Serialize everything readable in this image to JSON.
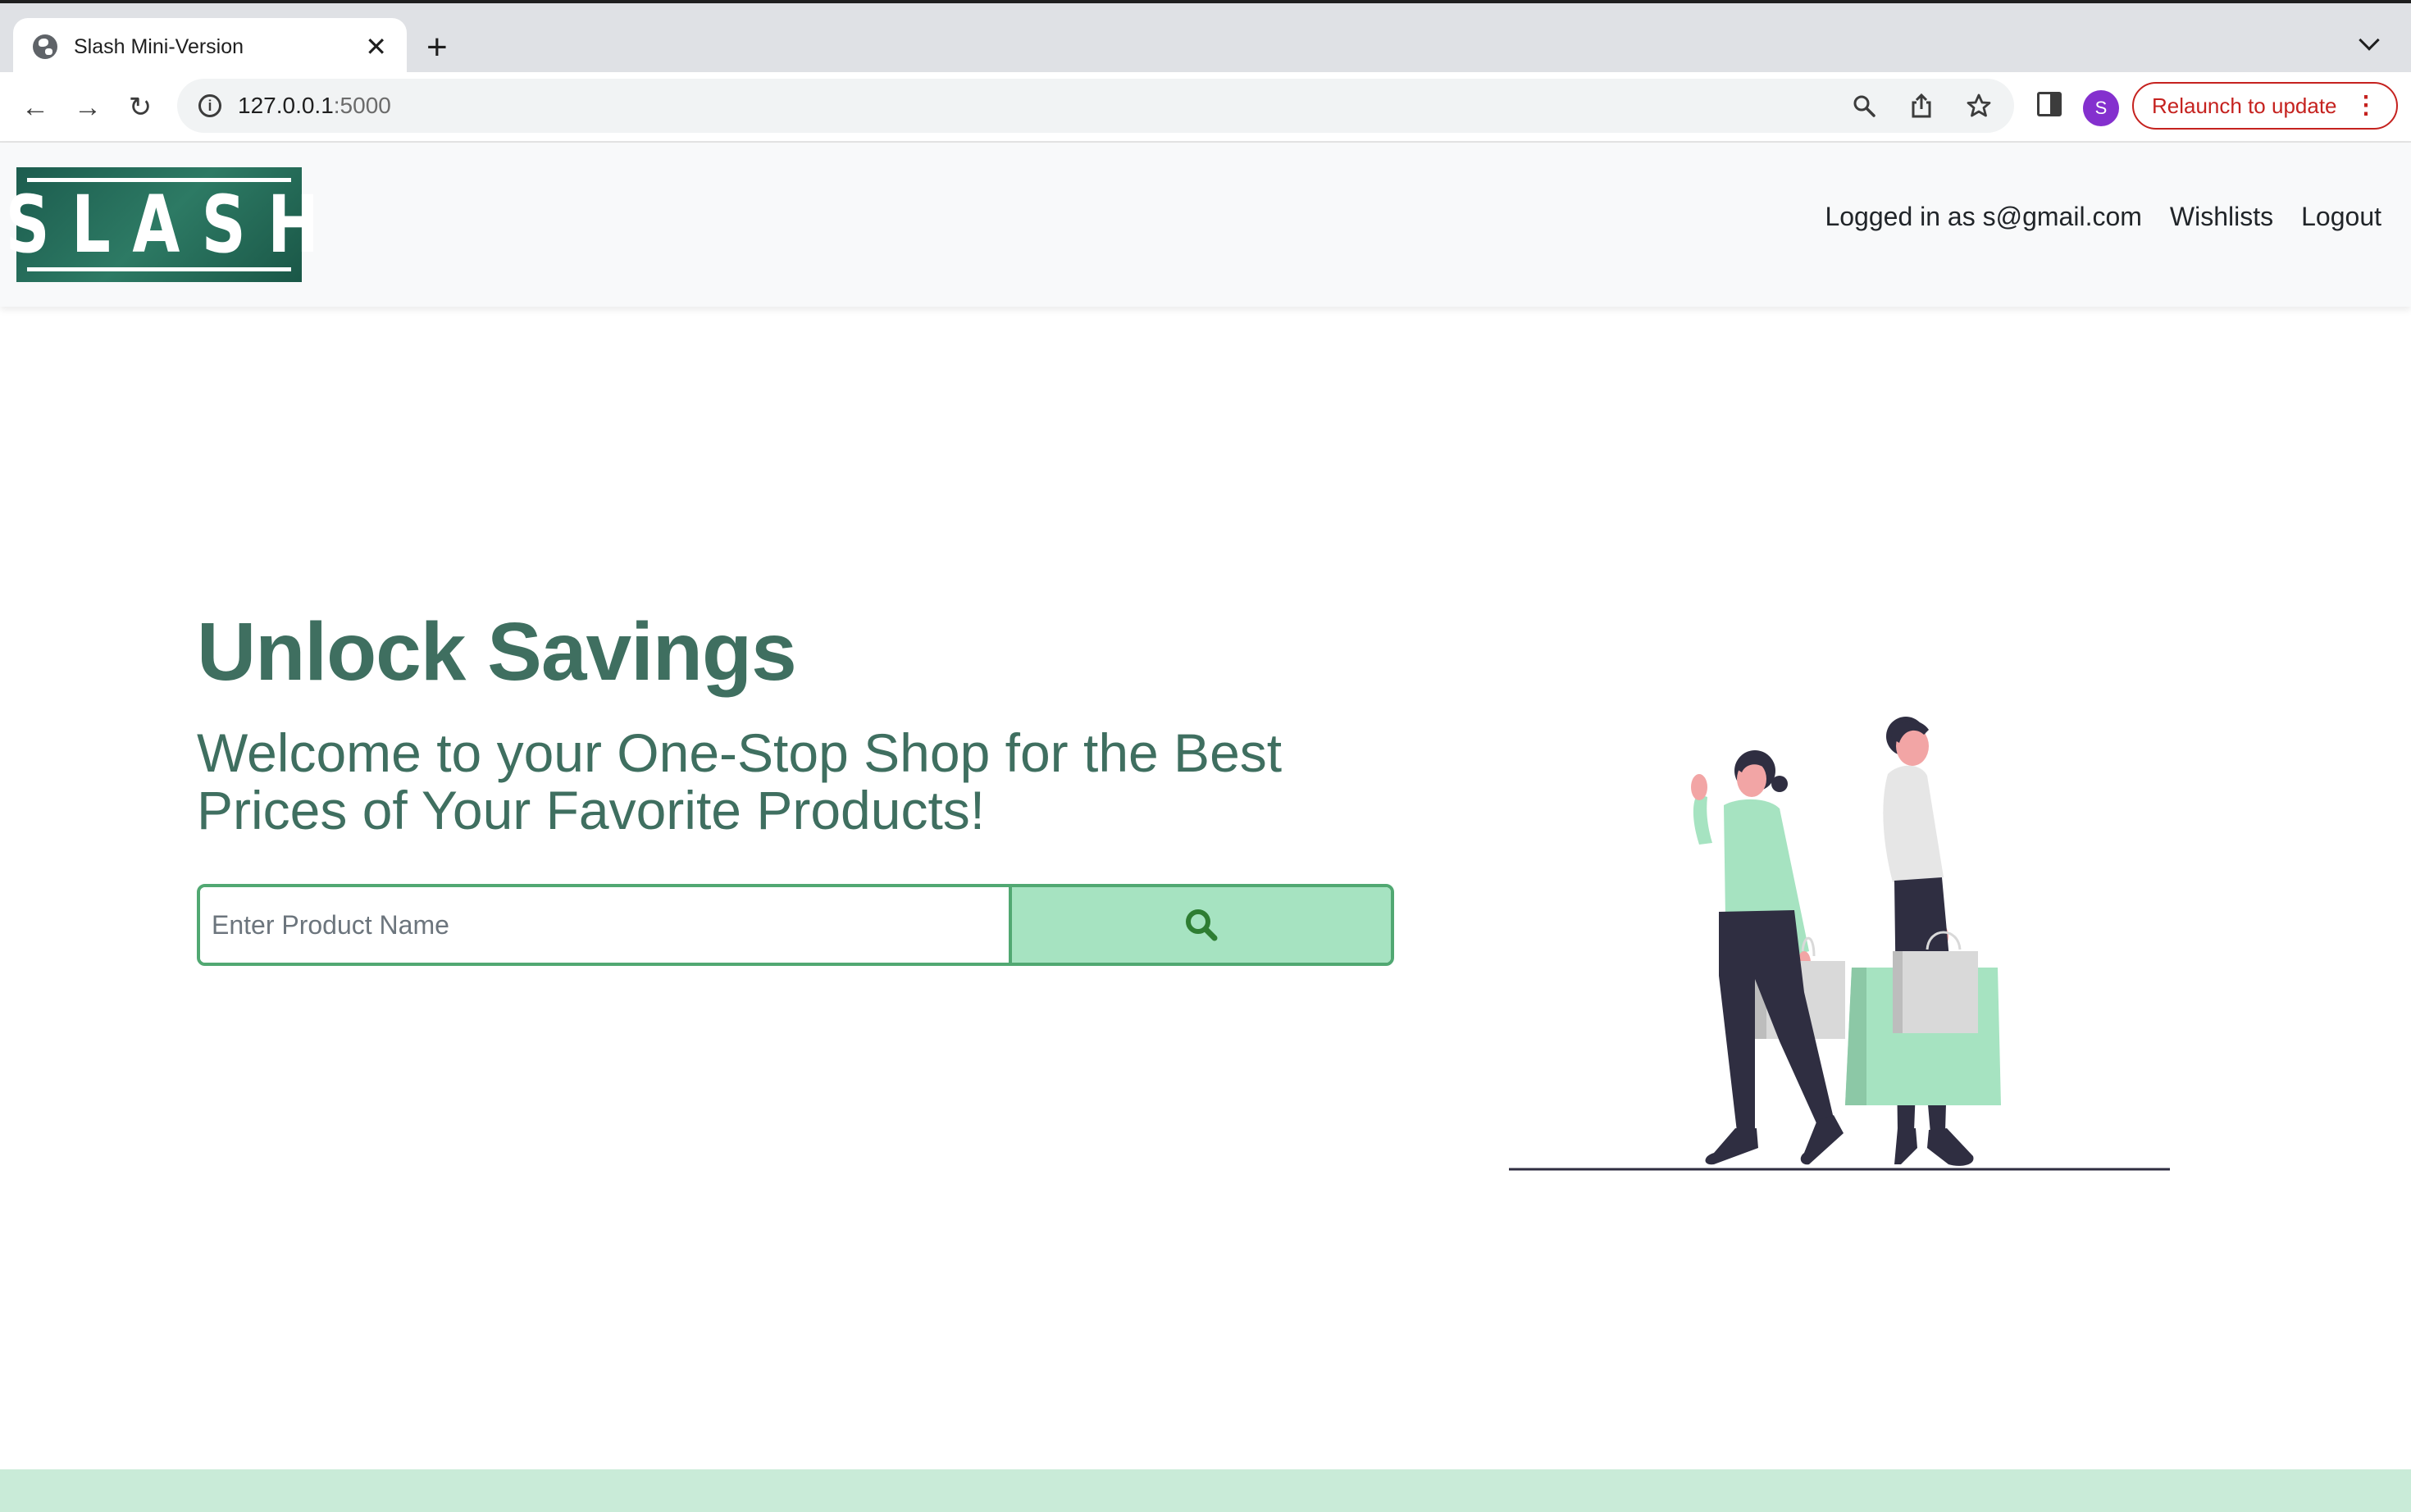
{
  "browser": {
    "tab_title": "Slash Mini-Version",
    "url_host": "127.0.0.1",
    "url_port": ":5000",
    "profile_initial": "S",
    "relaunch_label": "Relaunch to update"
  },
  "site": {
    "logo_text": "SLASH",
    "nav": {
      "logged_in": "Logged in as s@gmail.com",
      "wishlists": "Wishlists",
      "logout": "Logout"
    },
    "hero": {
      "title": "Unlock Savings",
      "subtitle": "Welcome to your One-Stop Shop for the Best Prices of Your Favorite Products!"
    },
    "search": {
      "placeholder": "Enter Product Name",
      "value": ""
    }
  },
  "colors": {
    "brand_green": "#3f6f60",
    "accent_mint": "#a6e3c1",
    "border_green": "#51a872",
    "search_icon": "#2e7d32",
    "relaunch_red": "#c5221f",
    "profile_purple": "#8430ce"
  },
  "icons": {
    "search_button": "magnifier-icon"
  }
}
